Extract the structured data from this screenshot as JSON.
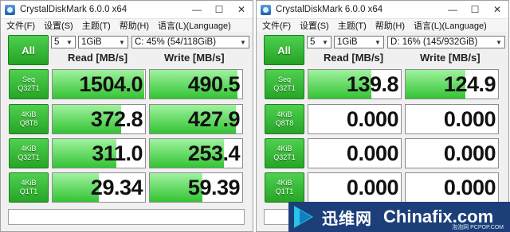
{
  "windows": [
    {
      "title": "CrystalDiskMark 6.0.0 x64",
      "menu": [
        "文件(F)",
        "设置(S)",
        "主题(T)",
        "帮助(H)",
        "语言(L)(Language)"
      ],
      "all_label": "All",
      "count": "5",
      "size": "1GiB",
      "drive": "C: 45% (54/118GiB)",
      "read_header": "Read [MB/s]",
      "write_header": "Write [MB/s]",
      "rows": [
        {
          "line1": "Seq",
          "line2": "Q32T1",
          "read": "1504.0",
          "write": "490.5",
          "read_fill": 0.995,
          "write_fill": 0.95
        },
        {
          "line1": "4KiB",
          "line2": "Q8T8",
          "read": "372.8",
          "write": "427.9",
          "read_fill": 0.74,
          "write_fill": 0.93
        },
        {
          "line1": "4KiB",
          "line2": "Q32T1",
          "read": "311.0",
          "write": "253.4",
          "read_fill": 0.69,
          "write_fill": 0.8
        },
        {
          "line1": "4KiB",
          "line2": "Q1T1",
          "read": "29.34",
          "write": "59.39",
          "read_fill": 0.5,
          "write_fill": 0.57
        }
      ],
      "comment": ""
    },
    {
      "title": "CrystalDiskMark 6.0.0 x64",
      "menu": [
        "文件(F)",
        "设置(S)",
        "主题(T)",
        "帮助(H)",
        "语言(L)(Language)"
      ],
      "all_label": "All",
      "count": "5",
      "size": "1GiB",
      "drive": "D: 16% (145/932GiB)",
      "read_header": "Read [MB/s]",
      "write_header": "Write [MB/s]",
      "rows": [
        {
          "line1": "Seq",
          "line2": "Q32T1",
          "read": "139.8",
          "write": "124.9",
          "read_fill": 0.68,
          "write_fill": 0.65
        },
        {
          "line1": "4KiB",
          "line2": "Q8T8",
          "read": "0.000",
          "write": "0.000",
          "read_fill": 0,
          "write_fill": 0
        },
        {
          "line1": "4KiB",
          "line2": "Q32T1",
          "read": "0.000",
          "write": "0.000",
          "read_fill": 0,
          "write_fill": 0
        },
        {
          "line1": "4KiB",
          "line2": "Q1T1",
          "read": "0.000",
          "write": "0.000",
          "read_fill": 0,
          "write_fill": 0
        }
      ],
      "comment": ""
    }
  ],
  "watermark": {
    "cn_text": "迅维网",
    "en_text": "Chinafix.com",
    "site": "泡泡网 PCPOP.COM"
  },
  "colors": {
    "button_green": "#2fb52f",
    "bar_green": "#66d966",
    "watermark_bg": "#1c3f7a"
  },
  "icons": [
    "app-icon",
    "minimize-icon",
    "maximize-icon",
    "close-icon",
    "chevron-down-icon",
    "watermark-logo-icon"
  ]
}
